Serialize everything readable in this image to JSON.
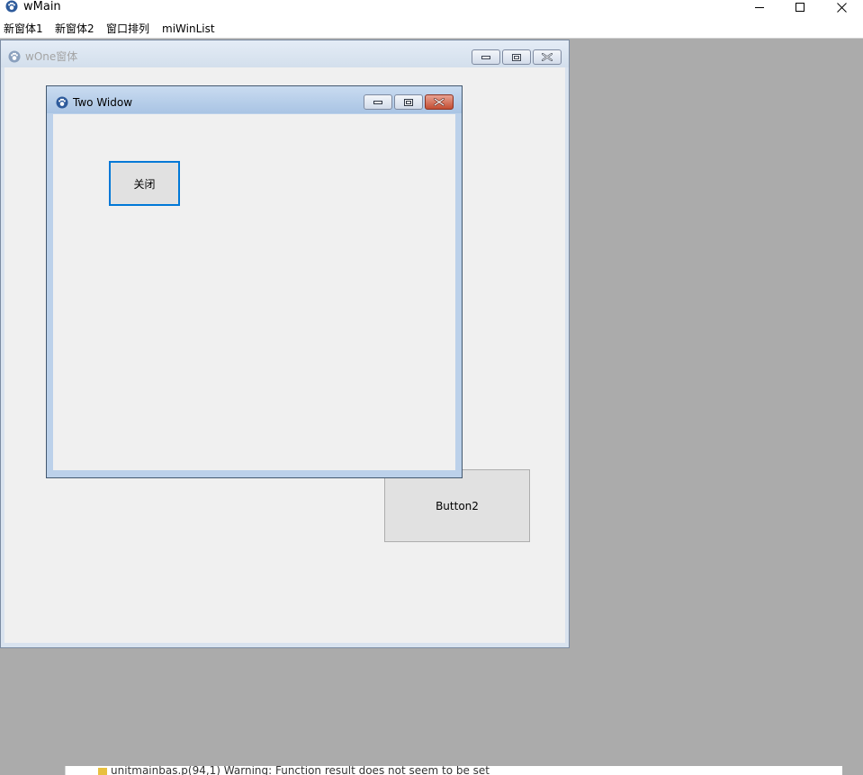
{
  "main_window": {
    "title": "wMain",
    "icon": "paw-icon"
  },
  "window_controls": {
    "minimize_icon": "minimize-icon",
    "maximize_icon": "maximize-icon",
    "close_icon": "close-icon"
  },
  "menu": {
    "items": [
      {
        "label": "新窗体1"
      },
      {
        "label": "新窗体2"
      },
      {
        "label": "窗口排列"
      },
      {
        "label": "miWinList"
      }
    ]
  },
  "windows": {
    "one": {
      "title": "wOne窗体",
      "state": "inactive",
      "button2_label": "Button2"
    },
    "two": {
      "title": "Two Widow",
      "state": "active",
      "close_button_label": "关闭"
    }
  },
  "log": {
    "partial_text": "unitmainbas.p(94,1) Warning: Function result does not seem to be set"
  },
  "colors": {
    "mdi_background": "#ababab",
    "focus_border": "#0078d7",
    "close_active": "#c34d32"
  }
}
